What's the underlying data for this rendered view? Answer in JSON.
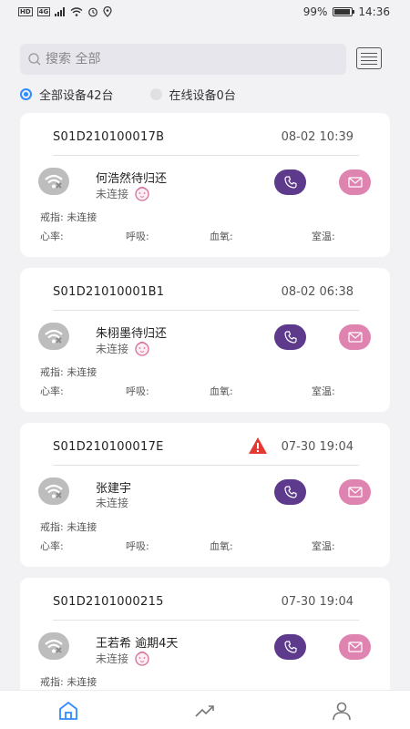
{
  "status_bar": {
    "left_labels": [
      "HD",
      "4G"
    ],
    "battery": "99%",
    "time": "14:36"
  },
  "search": {
    "placeholder": "搜索 全部"
  },
  "filters": [
    {
      "label": "全部设备42台",
      "selected": true
    },
    {
      "label": "在线设备0台",
      "selected": false
    }
  ],
  "labels": {
    "ring": "戒指:",
    "heart_rate": "心率:",
    "breath": "呼吸:",
    "blood_oxygen": "血氧:",
    "room_temp": "室温:"
  },
  "devices": [
    {
      "id": "S01D210100017B",
      "time": "08-02 10:39",
      "name": "何浩然待归还",
      "status": "未连接",
      "ring_value": "未连接",
      "alert": false
    },
    {
      "id": "S01D21010001B1",
      "time": "08-02 06:38",
      "name": "朱栩墨待归还",
      "status": "未连接",
      "ring_value": "未连接",
      "alert": false
    },
    {
      "id": "S01D210100017E",
      "time": "07-30 19:04",
      "name": "张建宇",
      "status": "未连接",
      "ring_value": "未连接",
      "alert": true
    },
    {
      "id": "S01D2101000215",
      "time": "07-30 19:04",
      "name": "王若希 逾期4天",
      "status": "未连接",
      "ring_value": "未连接",
      "alert": false
    }
  ],
  "colors": {
    "accent_blue": "#2f8bff",
    "call_purple": "#5e3a8c",
    "message_pink": "#df84b0",
    "alert_red": "#e53935",
    "wifi_gray": "#bdbdbd"
  },
  "nav": [
    {
      "icon": "home-icon",
      "active": true
    },
    {
      "icon": "trend-icon",
      "active": false
    },
    {
      "icon": "user-icon",
      "active": false
    }
  ]
}
